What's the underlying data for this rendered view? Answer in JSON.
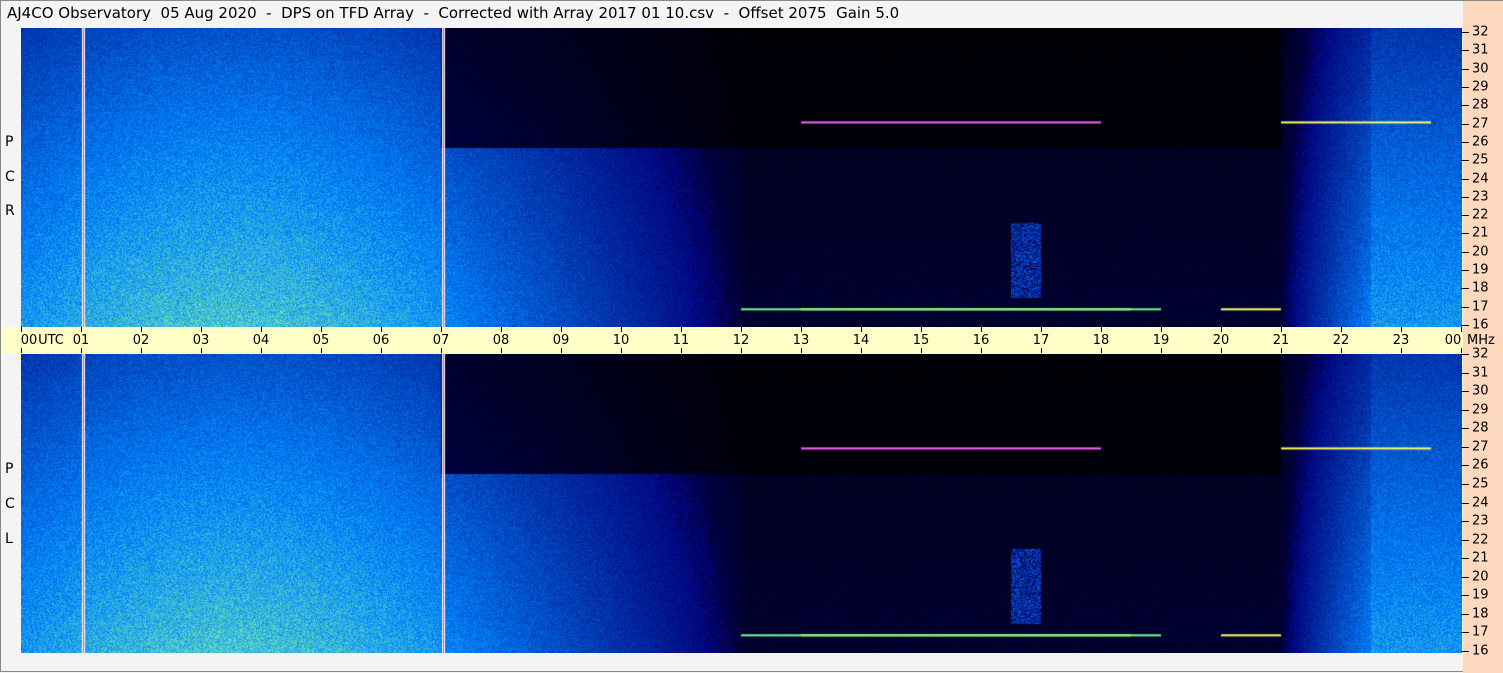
{
  "title": "AJ4CO Observatory  05 Aug 2020  -  DPS on TFD Array  -  Corrected with Array 2017 01 10.csv  -  Offset 2075  Gain 5.0",
  "top_panel": {
    "polarization": [
      "R",
      "C",
      "P"
    ]
  },
  "bottom_panel": {
    "polarization": [
      "L",
      "C",
      "P"
    ]
  },
  "x_axis": {
    "labels": [
      "00",
      "01",
      "02",
      "03",
      "04",
      "05",
      "06",
      "07",
      "08",
      "09",
      "10",
      "11",
      "12",
      "13",
      "14",
      "15",
      "16",
      "17",
      "18",
      "19",
      "20",
      "21",
      "22",
      "23",
      "00"
    ],
    "utc_label": "UTC",
    "unit_label": "MHz"
  },
  "y_axis": {
    "labels": [
      "32",
      "31",
      "30",
      "29",
      "28",
      "27",
      "26",
      "25",
      "24",
      "23",
      "22",
      "21",
      "20",
      "19",
      "18",
      "17",
      "16"
    ]
  },
  "colors": {
    "axis_bg": "#ffffc8",
    "right_bg": "#fcd8bf",
    "marker_line": "#ffffff"
  }
}
